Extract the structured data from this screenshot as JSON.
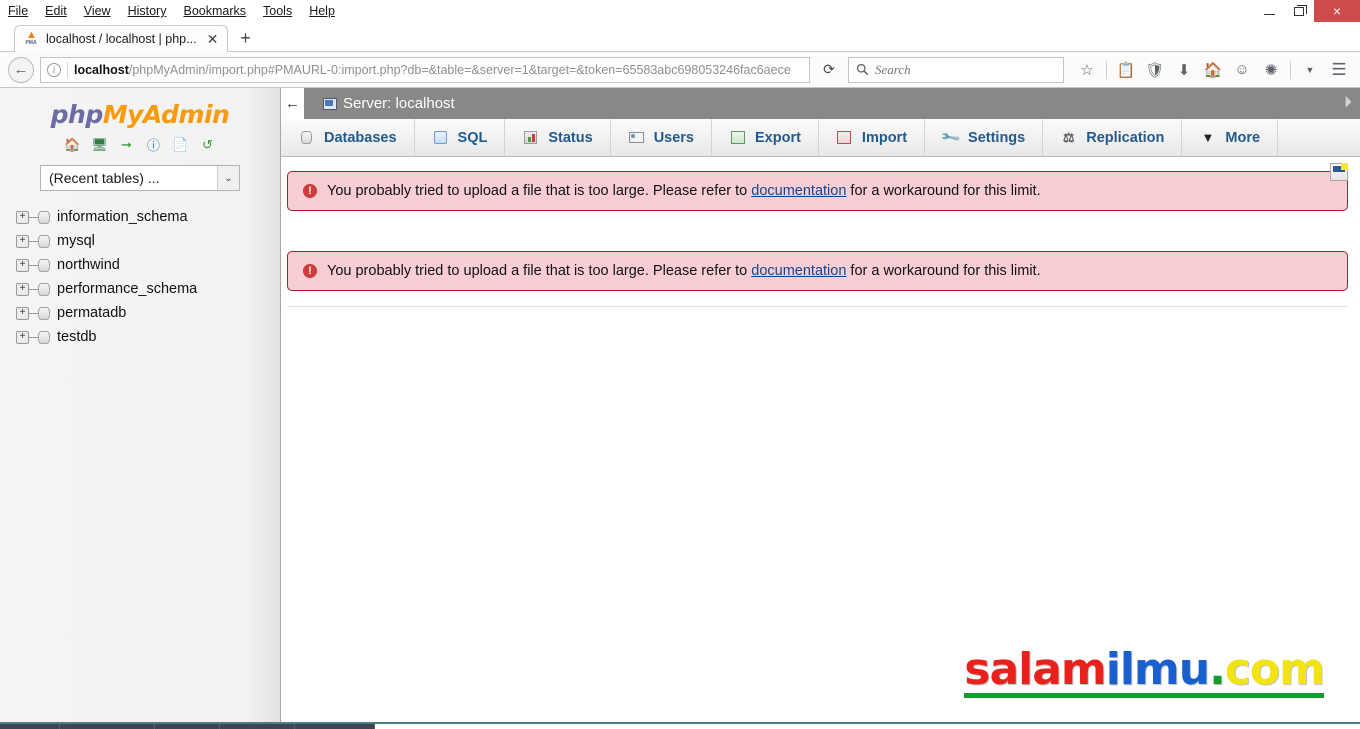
{
  "browser": {
    "menu": [
      "File",
      "Edit",
      "View",
      "History",
      "Bookmarks",
      "Tools",
      "Help"
    ],
    "window_controls": {
      "minimize": "minimize-button",
      "restore": "restore-button",
      "close": "×"
    },
    "tab": {
      "favicon_flame": "Ж",
      "favicon_text": "PMA",
      "title": "localhost / localhost | php...",
      "close": "✕",
      "new_tab": "+"
    },
    "nav": {
      "back": "←",
      "reload": "⟳",
      "url_host": "localhost",
      "url_rest": "/phpMyAdmin/import.php#PMAURL-0:import.php?db=&table=&server=1&target=&token=65583abc698053246fac6aece"
    },
    "search": {
      "icon": "search-icon",
      "placeholder": "Search",
      "value": ""
    },
    "toolbar_icons": [
      "star-icon",
      "reading-list-icon",
      "pocket-shield-icon",
      "download-icon",
      "home-icon",
      "smiley-feedback-icon",
      "scribble-icon",
      "chevron-down-icon",
      "hamburger-menu-icon"
    ]
  },
  "sidebar": {
    "logo": {
      "php": "php",
      "myadmin": "MyAdmin"
    },
    "icons": [
      "home-icon",
      "console-icon",
      "logout-icon",
      "documentation-icon",
      "blank-doc-icon",
      "reload-icon"
    ],
    "recent_select": {
      "value": "(Recent tables) ...",
      "caret": "⌄"
    },
    "databases": [
      {
        "name": "information_schema",
        "expand": "+"
      },
      {
        "name": "mysql",
        "expand": "+"
      },
      {
        "name": "northwind",
        "expand": "+"
      },
      {
        "name": "performance_schema",
        "expand": "+"
      },
      {
        "name": "permatadb",
        "expand": "+"
      },
      {
        "name": "testdb",
        "expand": "+"
      }
    ]
  },
  "main": {
    "server_bar": {
      "back_arrow": "←",
      "title": "Server: localhost",
      "collapse": "⤒"
    },
    "tabs": [
      {
        "label": "Databases",
        "icon": "database-icon"
      },
      {
        "label": "SQL",
        "icon": "sql-scroll-icon"
      },
      {
        "label": "Status",
        "icon": "status-chart-icon"
      },
      {
        "label": "Users",
        "icon": "users-card-icon"
      },
      {
        "label": "Export",
        "icon": "export-icon"
      },
      {
        "label": "Import",
        "icon": "import-icon"
      },
      {
        "label": "Settings",
        "icon": "wrench-icon"
      },
      {
        "label": "Replication",
        "icon": "replication-icon"
      },
      {
        "label": "More",
        "icon": "chevron-down-icon"
      }
    ],
    "messages": [
      {
        "icon": "error-icon",
        "text_before": "You probably tried to upload a file that is too large. Please refer to ",
        "link": "documentation",
        "text_after": " for a workaround for this limit."
      },
      {
        "icon": "error-icon",
        "text_before": "You probably tried to upload a file that is too large. Please refer to ",
        "link": "documentation",
        "text_after": " for a workaround for this limit."
      }
    ],
    "panel_icon": "console-panel-icon",
    "watermark": {
      "part1": "salam",
      "part2": "ilmu",
      "dot": ".",
      "part3": "com"
    }
  },
  "colors": {
    "error_bg": "#f8cdd4",
    "error_border": "#9c2533",
    "tab_text": "#235a8c",
    "server_bar": "#888888",
    "logo_orange": "#f89a0e",
    "logo_purple": "#6c6ca5"
  }
}
